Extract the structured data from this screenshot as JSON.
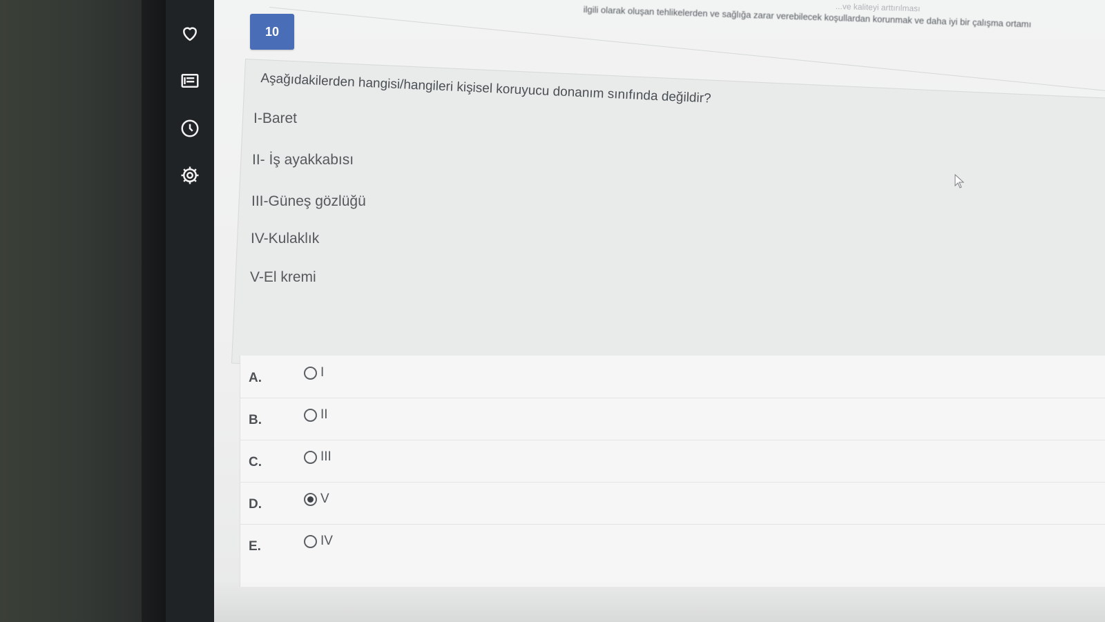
{
  "sidebar": {
    "icons": [
      "heart-icon",
      "document-icon",
      "clock-icon",
      "gear-icon"
    ]
  },
  "header": {
    "partial_top_text": "...ve kaliteyi arttırılması",
    "partial_line": "ilgili olarak oluşan tehlikelerden ve sağlığa zarar verebilecek koşullardan korunmak ve daha iyi bir çalışma ortamı"
  },
  "question": {
    "number": "10",
    "text": "Aşağıdakilerden hangisi/hangileri kişisel koruyucu donanım sınıfında değildir?",
    "statements": [
      "I-Baret",
      "II- İş ayakkabısı",
      "III-Güneş gözlüğü",
      "IV-Kulaklık",
      "V-El kremi"
    ]
  },
  "options": [
    {
      "letter": "A.",
      "label": "I",
      "selected": false
    },
    {
      "letter": "B.",
      "label": "II",
      "selected": false
    },
    {
      "letter": "C.",
      "label": "III",
      "selected": false
    },
    {
      "letter": "D.",
      "label": "V",
      "selected": true
    },
    {
      "letter": "E.",
      "label": "IV",
      "selected": false
    }
  ],
  "colors": {
    "accent": "#4a6db8",
    "sidebar": "#1f2326",
    "background": "#efefef"
  }
}
